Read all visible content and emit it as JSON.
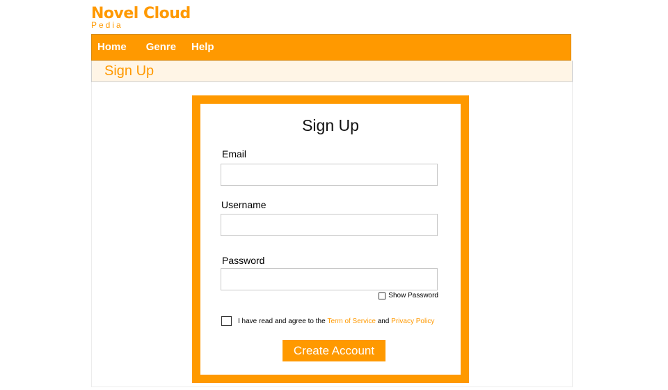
{
  "brand": {
    "title": "Novel Cloud",
    "subtitle": "Pedia",
    "color": "#ff9900"
  },
  "nav": {
    "items": [
      {
        "label": "Home"
      },
      {
        "label": "Genre"
      },
      {
        "label": "Help"
      }
    ]
  },
  "breadcrumb": {
    "title": "Sign Up"
  },
  "form": {
    "title": "Sign Up",
    "email": {
      "label": "Email",
      "value": "",
      "placeholder": ""
    },
    "username": {
      "label": "Username",
      "value": "",
      "placeholder": ""
    },
    "password": {
      "label": "Password",
      "value": "",
      "placeholder": ""
    },
    "show_password": {
      "label": "Show Password",
      "checked": false
    },
    "agree": {
      "prefix": "I have read and agree to the",
      "terms_link": "Term of Service",
      "and": "and",
      "privacy_link": "Privacy Policy",
      "checked": false
    },
    "submit_label": "Create Account"
  }
}
